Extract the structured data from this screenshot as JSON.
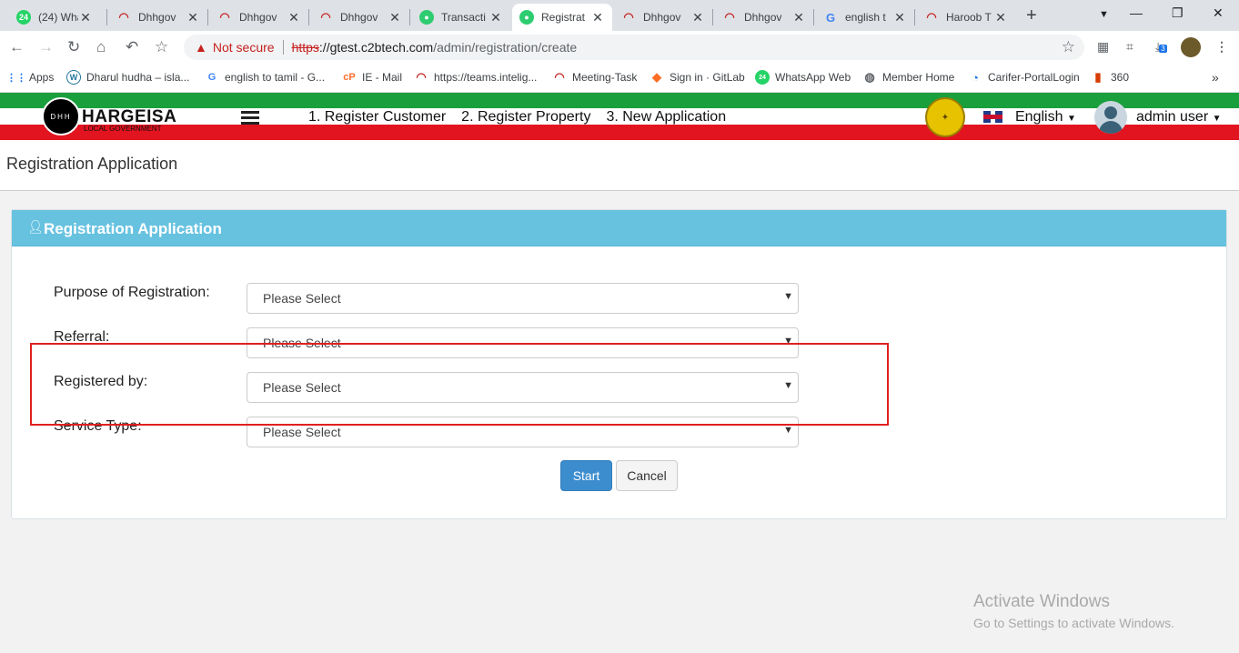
{
  "browser": {
    "tabs": [
      {
        "title": "(24) Wha",
        "icon": "whatsapp-icon",
        "badge": "24"
      },
      {
        "title": "Dhhgov",
        "icon": "arc-icon"
      },
      {
        "title": "Dhhgov",
        "icon": "arc-icon"
      },
      {
        "title": "Dhhgov",
        "icon": "arc-icon"
      },
      {
        "title": "Transacti",
        "icon": "owl-icon"
      },
      {
        "title": "Registrat",
        "icon": "owl-icon",
        "active": true
      },
      {
        "title": "Dhhgov",
        "icon": "arc-icon"
      },
      {
        "title": "Dhhgov",
        "icon": "arc-icon"
      },
      {
        "title": "english t",
        "icon": "google-icon",
        "glyph": "G"
      },
      {
        "title": "Haroob T",
        "icon": "arc-icon"
      }
    ],
    "address": {
      "security": "Not secure",
      "scheme": "https",
      "host": "://gtest.c2btech.com",
      "path": "/admin/registration/create"
    },
    "download_count": "3",
    "bookmarks": [
      {
        "label": "Apps",
        "icon": "apps-grid-icon"
      },
      {
        "label": "Dharul hudha – isla...",
        "icon": "wordpress-icon",
        "glyph": "W"
      },
      {
        "label": "english to tamil - G...",
        "icon": "google-icon",
        "glyph": "G"
      },
      {
        "label": "IE - Mail",
        "icon": "cpanel-icon",
        "glyph": "cP"
      },
      {
        "label": "https://teams.intelig...",
        "icon": "arc-icon"
      },
      {
        "label": "Meeting-Task",
        "icon": "arc-icon"
      },
      {
        "label": "Sign in · GitLab",
        "icon": "gitlab-icon"
      },
      {
        "label": "WhatsApp Web",
        "icon": "whatsapp-icon",
        "glyph": "24"
      },
      {
        "label": "Member Home",
        "icon": "globe-icon"
      },
      {
        "label": "Carifer-PortalLogin",
        "icon": "carifer-icon"
      },
      {
        "label": "360",
        "icon": "office-icon"
      }
    ]
  },
  "app": {
    "logo_initials": "DHH",
    "logo_title": "HARGEISA",
    "logo_subtitle": "LOCAL GOVERNMENT",
    "nav": [
      "1. Register Customer",
      "2. Register Property",
      "3. New Application"
    ],
    "language": "English",
    "user": "admin user"
  },
  "page": {
    "title": "Registration Application",
    "panel_title": "Registration Application",
    "fields": [
      {
        "label": "Purpose of Registration:",
        "value": "Please Select"
      },
      {
        "label": "Referral:",
        "value": "Please Select"
      },
      {
        "label": "Registered by:",
        "value": "Please Select"
      },
      {
        "label": "Service Type:",
        "value": "Please Select"
      }
    ],
    "start_label": "Start",
    "cancel_label": "Cancel"
  },
  "watermark": {
    "line1": "Activate Windows",
    "line2": "Go to Settings to activate Windows."
  },
  "colors": {
    "panel_header": "#67c2e0",
    "start_button": "#3c8dce",
    "green_stripe": "#1a9f3d",
    "red_stripe": "#e2141f",
    "highlight_box": "#e02020"
  }
}
